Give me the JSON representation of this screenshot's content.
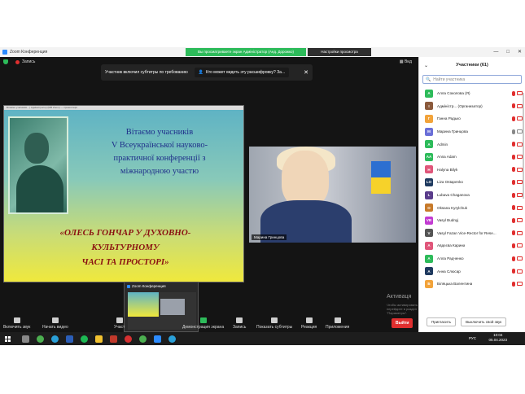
{
  "window": {
    "app_title": "Zoom Конференция",
    "notice": "Вы просматриваете экран Адміністратор (Анд. Дорожко)",
    "view_options": "Настройки просмотра",
    "controls": [
      "—",
      "□",
      "✕"
    ]
  },
  "meeting": {
    "recording_label": "Запись",
    "view_label": "Вид",
    "caption_bar": {
      "message": "Участник включил субтитры по требованию",
      "link": "Кто может видеть эту расшифровку? За..."
    },
    "shared_screen": {
      "window_caption": "Вітаємо учасників... | Адміністратор (Мій Zoom) — презентація",
      "greeting_lines": [
        "Вітаємо учасників",
        "V Всеукраїнської науково-",
        "практичної конференції з",
        "міжнародною участю"
      ],
      "theme_lines": [
        "«ОЛЕСЬ ГОНЧАР У ДУХОВНО-",
        "КУЛЬТУРНОМУ",
        "ЧАСІ ТА ПРОСТОРІ»"
      ]
    },
    "video": {
      "name_label": "Марина Гринцова"
    },
    "popup": {
      "title": "Zoom Конференция"
    },
    "activation": {
      "title": "Активаця",
      "sub": "Чтобы активировать Windows, перейдите в раздел \"Параметры\"."
    },
    "toolbar": {
      "mute": "Включить звук",
      "video": "Начать видео",
      "participants": "Участ",
      "share": "Демонстрация экрана",
      "record": "Запись",
      "captions": "Показать субтитры",
      "reactions": "Реакция",
      "apps": "Приложения",
      "leave": "Выйти"
    }
  },
  "participants_panel": {
    "title": "Участники (61)",
    "search_placeholder": "Найти участника",
    "list": [
      {
        "initials": "A",
        "color": "#2dbb5a",
        "name": "Алла Соколова (Я)",
        "mic": "off",
        "cam": "off"
      },
      {
        "initials": "I",
        "color": "#8b5a3c",
        "name": "Адміністр... (Организатор)",
        "mic": "off",
        "cam": "off"
      },
      {
        "initials": "Г",
        "color": "#f2a33a",
        "name": "Ганна Радько",
        "mic": "off",
        "cam": "off"
      },
      {
        "initials": "M",
        "color": "#6a6fd8",
        "name": "Марина Гринцова",
        "mic": "on",
        "cam": "on"
      },
      {
        "initials": "A",
        "color": "#2dbb5a",
        "name": "Admin",
        "mic": "off",
        "cam": "off"
      },
      {
        "initials": "AA",
        "color": "#2dbb5a",
        "name": "Anna Adam",
        "mic": "off",
        "cam": "off"
      },
      {
        "initials": "H",
        "color": "#e0567a",
        "name": "Halyna Bilyk",
        "mic": "off",
        "cam": "off"
      },
      {
        "initials": "LO",
        "color": "#1f3a5f",
        "name": "Liza Ostapenko",
        "mic": "off",
        "cam": "off"
      },
      {
        "initials": "L",
        "color": "#5a3c8b",
        "name": "Lubava Chaganova",
        "mic": "off",
        "cam": "off"
      },
      {
        "initials": "O",
        "color": "#c77a2a",
        "name": "Oksana Kyrylchuk",
        "mic": "off",
        "cam": "off"
      },
      {
        "initials": "VB",
        "color": "#c23ad1",
        "name": "Vasyl Budnyj",
        "mic": "off",
        "cam": "off"
      },
      {
        "initials": "V",
        "color": "#555555",
        "name": "Vasyl Fazan Vice-Rector for Rese...",
        "mic": "off",
        "cam": "off"
      },
      {
        "initials": "A",
        "color": "#e0567a",
        "name": "Авдєєва Карина",
        "mic": "off",
        "cam": "off"
      },
      {
        "initials": "A",
        "color": "#2dbb5a",
        "name": "Алла Радченко",
        "mic": "off",
        "cam": "off"
      },
      {
        "initials": "A",
        "color": "#1f3a5f",
        "name": "Анна Слюсар",
        "mic": "off",
        "cam": "off"
      },
      {
        "initials": "Б",
        "color": "#f2a33a",
        "name": "Біляцька Валентина",
        "mic": "off",
        "cam": "off"
      }
    ],
    "invite_button": "Пригласить",
    "mute_all_button": "Выключить свой звук"
  },
  "taskbar": {
    "lang": "РУС",
    "time": "10:04",
    "date": "05.04.2023"
  },
  "colors": {
    "zoom_blue": "#2d8cff",
    "green": "#2dbb5a",
    "leave_red": "#e02f2f"
  }
}
